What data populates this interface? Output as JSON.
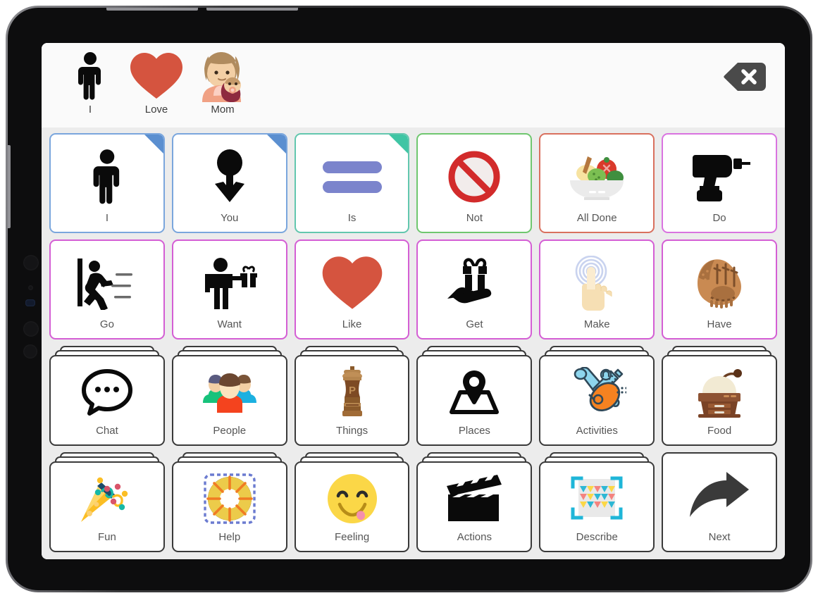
{
  "app": {
    "type": "aac-communication-board",
    "device": "tablet"
  },
  "sentence_bar": {
    "background": "#fafafa",
    "chips": [
      {
        "label": "I",
        "icon": "person-standing-icon"
      },
      {
        "label": "Love",
        "icon": "red-heart-icon"
      },
      {
        "label": "Mom",
        "icon": "woman-holding-baby-icon"
      }
    ],
    "delete_button": {
      "icon": "backspace-delete-icon",
      "aria_label": "Delete",
      "color": "#4a4a4a"
    }
  },
  "grid": {
    "columns": 6,
    "rows": 4,
    "background": "#ececec",
    "tiles": [
      {
        "label": "I",
        "icon": "person-standing-icon",
        "type": "word",
        "border": "#7aa6dd",
        "fold": "#5b8fd0"
      },
      {
        "label": "You",
        "icon": "down-arrow-person-icon",
        "type": "word",
        "border": "#7aa6dd",
        "fold": "#5b8fd0"
      },
      {
        "label": "Is",
        "icon": "equals-sign-icon",
        "type": "word",
        "border": "#62c7ae",
        "fold": "#3fc5a4"
      },
      {
        "label": "Not",
        "icon": "prohibited-sign-icon",
        "type": "word",
        "border": "#6fc76f",
        "fold": null
      },
      {
        "label": "All Done",
        "icon": "salad-bowl-icon",
        "type": "word",
        "border": "#d9705e",
        "fold": null
      },
      {
        "label": "Do",
        "icon": "power-drill-icon",
        "type": "word",
        "border": "#d973e0",
        "fold": null
      },
      {
        "label": "Go",
        "icon": "running-exit-icon",
        "type": "word",
        "border": "#d45ed4",
        "fold": null
      },
      {
        "label": "Want",
        "icon": "person-holding-gift-icon",
        "type": "word",
        "border": "#d45ed4",
        "fold": null
      },
      {
        "label": "Like",
        "icon": "red-heart-icon",
        "type": "word",
        "border": "#d45ed4",
        "fold": null
      },
      {
        "label": "Get",
        "icon": "gift-in-hand-icon",
        "type": "word",
        "border": "#d45ed4",
        "fold": null
      },
      {
        "label": "Make",
        "icon": "tapping-finger-icon",
        "type": "word",
        "border": "#d45ed4",
        "fold": null
      },
      {
        "label": "Have",
        "icon": "baseball-glove-icon",
        "type": "word",
        "border": "#d45ed4",
        "fold": null
      },
      {
        "label": "Chat",
        "icon": "speech-bubble-icon",
        "type": "folder",
        "border": "#3a3a3a",
        "fold": null
      },
      {
        "label": "People",
        "icon": "group-of-people-icon",
        "type": "folder",
        "border": "#3a3a3a",
        "fold": null
      },
      {
        "label": "Things",
        "icon": "pepper-mill-icon",
        "type": "folder",
        "border": "#3a3a3a",
        "fold": null
      },
      {
        "label": "Places",
        "icon": "map-pin-icon",
        "type": "folder",
        "border": "#3a3a3a",
        "fold": null
      },
      {
        "label": "Activities",
        "icon": "guitar-and-bat-icon",
        "type": "folder",
        "border": "#3a3a3a",
        "fold": null
      },
      {
        "label": "Food",
        "icon": "coffee-grinder-icon",
        "type": "folder",
        "border": "#3a3a3a",
        "fold": null
      },
      {
        "label": "Fun",
        "icon": "party-popper-icon",
        "type": "folder",
        "border": "#3a3a3a",
        "fold": null
      },
      {
        "label": "Help",
        "icon": "life-ring-icon",
        "type": "folder",
        "border": "#3a3a3a",
        "fold": null
      },
      {
        "label": "Feeling",
        "icon": "yummy-face-icon",
        "type": "folder",
        "border": "#3a3a3a",
        "fold": null
      },
      {
        "label": "Actions",
        "icon": "clapperboard-icon",
        "type": "folder",
        "border": "#3a3a3a",
        "fold": null
      },
      {
        "label": "Describe",
        "icon": "pattern-crop-icon",
        "type": "folder",
        "border": "#3a3a3a",
        "fold": null
      },
      {
        "label": "Next",
        "icon": "curved-right-arrow-icon",
        "type": "word",
        "border": "#3a3a3a",
        "fold": null
      }
    ]
  },
  "colors": {
    "heart_red": "#d5543f",
    "not_red": "#d22b2b",
    "is_blue": "#7b84cc",
    "tile_label": "#555555",
    "chip_label": "#3d3d3d",
    "grid_bg": "#ececec",
    "bar_bg": "#fafafa"
  }
}
